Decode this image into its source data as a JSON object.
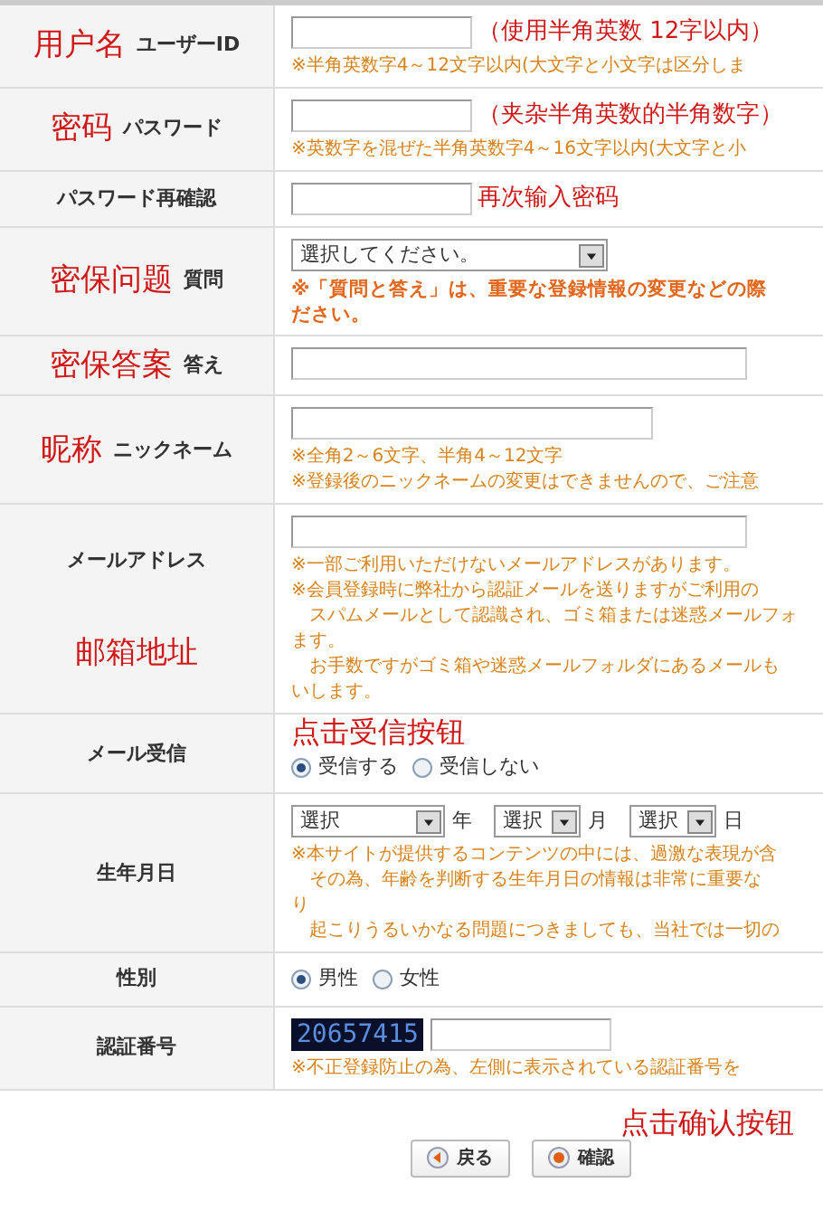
{
  "rows": [
    {
      "label": [
        {
          "kind": "note",
          "text": "用户名"
        },
        {
          "kind": "label",
          "text": "ユーザーID"
        }
      ],
      "field": {
        "kind": "text-short",
        "annotation": "（使用半角英数 12字以内）"
      },
      "notes": [
        {
          "text": "※半角英数字4～12文字以内(大文字と小文字は区分しま",
          "emphasis": false
        }
      ]
    },
    {
      "label": [
        {
          "kind": "note",
          "text": "密码"
        },
        {
          "kind": "label",
          "text": "パスワード"
        }
      ],
      "field": {
        "kind": "text-short",
        "annotation": "（夹杂半角英数的半角数字）"
      },
      "notes": [
        {
          "text": "※英数字を混ぜた半角英数字4～16文字以内(大文字と小",
          "emphasis": false
        }
      ]
    },
    {
      "label": [
        {
          "kind": "label",
          "text": "パスワード再確認"
        }
      ],
      "field": {
        "kind": "text-short",
        "annotation": "再次输入密码"
      }
    },
    {
      "label": [
        {
          "kind": "note",
          "text": "密保问题"
        },
        {
          "kind": "label",
          "text": "質問"
        }
      ],
      "field": {
        "kind": "select",
        "value": "選択してください。"
      },
      "notes": [
        {
          "text": "※「質問と答え」は、重要な登録情報の変更などの際",
          "emphasis": true
        },
        {
          "text": "ださい。",
          "emphasis": true
        }
      ]
    },
    {
      "label": [
        {
          "kind": "note",
          "text": "密保答案"
        },
        {
          "kind": "label",
          "text": "答え"
        }
      ],
      "field": {
        "kind": "text-long"
      }
    },
    {
      "label": [
        {
          "kind": "note",
          "text": "昵称"
        },
        {
          "kind": "label",
          "text": "ニックネーム"
        }
      ],
      "field": {
        "kind": "text-medium"
      },
      "notes": [
        {
          "text": "※全角2～6文字、半角4～12文字",
          "emphasis": false
        },
        {
          "text": "※登録後のニックネームの変更はできませんので、ご注意",
          "emphasis": false
        }
      ]
    },
    {
      "label": [
        {
          "kind": "label",
          "text": "メールアドレス"
        },
        {
          "kind": "note",
          "text": "邮箱地址"
        }
      ],
      "field": {
        "kind": "text-long"
      },
      "notes": [
        {
          "text": "※一部ご利用いただけないメールアドレスがあります。",
          "emphasis": false
        },
        {
          "text": "※会員登録時に弊社から認証メールを送りますがご利用の",
          "emphasis": false
        },
        {
          "text": "　スパムメールとして認識され、ゴミ箱または迷惑メールフォ",
          "emphasis": false
        },
        {
          "text": "ます。",
          "emphasis": false
        },
        {
          "text": "　お手数ですがゴミ箱や迷惑メールフォルダにあるメールも",
          "emphasis": false
        },
        {
          "text": "いします。",
          "emphasis": false
        }
      ]
    },
    {
      "label": [
        {
          "kind": "label",
          "text": "メール受信"
        }
      ],
      "field": {
        "kind": "radio",
        "annotation": "点击受信按钮",
        "options": [
          {
            "text": "受信する",
            "selected": true
          },
          {
            "text": "受信しない",
            "selected": false
          }
        ]
      }
    },
    {
      "label": [
        {
          "kind": "label",
          "text": "生年月日"
        }
      ],
      "field": {
        "kind": "date",
        "parts": [
          {
            "value": "選択",
            "unit": "年"
          },
          {
            "value": "選択",
            "unit": "月"
          },
          {
            "value": "選択",
            "unit": "日"
          }
        ]
      },
      "notes": [
        {
          "text": "※本サイトが提供するコンテンツの中には、過激な表現が含",
          "emphasis": false
        },
        {
          "text": "　その為、年齢を判断する生年月日の情報は非常に重要な",
          "emphasis": false
        },
        {
          "text": "り",
          "emphasis": false
        },
        {
          "text": "　起こりうるいかなる問題につきましても、当社では一切の",
          "emphasis": false
        }
      ]
    },
    {
      "label": [
        {
          "kind": "label",
          "text": "性別"
        }
      ],
      "field": {
        "kind": "radio",
        "options": [
          {
            "text": "男性",
            "selected": true
          },
          {
            "text": "女性",
            "selected": false
          }
        ]
      }
    },
    {
      "label": [
        {
          "kind": "label",
          "text": "認証番号"
        }
      ],
      "field": {
        "kind": "captcha",
        "code": "20657415"
      },
      "notes": [
        {
          "text": "※不正登録防止の為、左側に表示されている認証番号を",
          "emphasis": false
        }
      ]
    }
  ],
  "footer": {
    "annotation": "点击确认按钮",
    "buttons": [
      {
        "kind": "back",
        "text": "戻る"
      },
      {
        "kind": "confirm",
        "text": "確認"
      }
    ]
  }
}
